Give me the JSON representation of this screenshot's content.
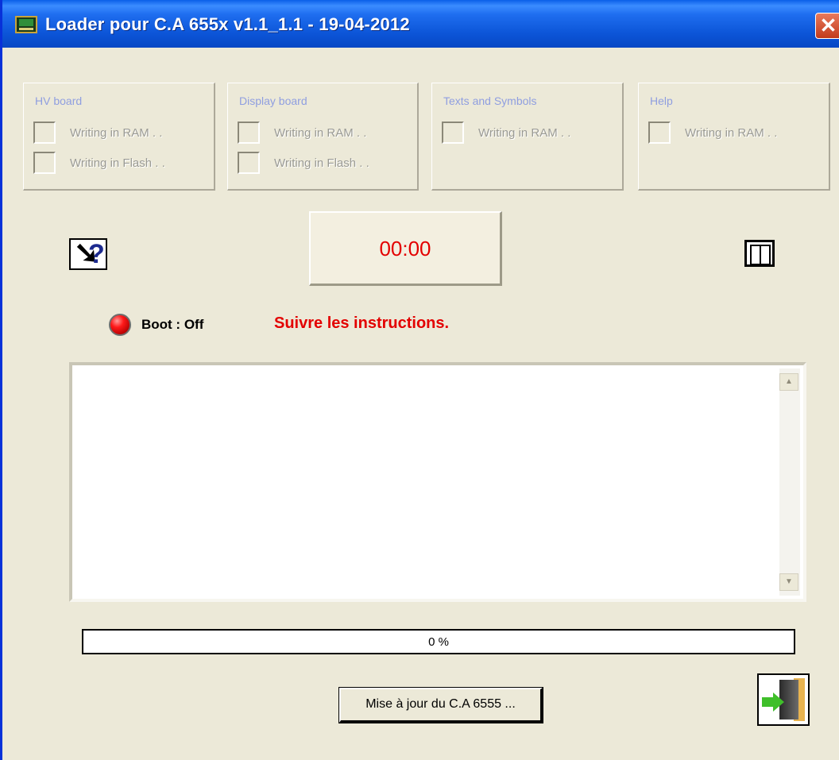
{
  "window": {
    "title": "Loader pour C.A 655x  v1.1_1.1 - 19-04-2012",
    "close_glyph": "✕"
  },
  "groups": [
    {
      "title": "HV board",
      "items": [
        "Writing in RAM . .",
        "Writing in Flash . ."
      ]
    },
    {
      "title": "Display board",
      "items": [
        "Writing in RAM . .",
        "Writing in Flash . ."
      ]
    },
    {
      "title": "Texts and Symbols",
      "items": [
        "Writing in RAM . ."
      ]
    },
    {
      "title": "Help",
      "items": [
        "Writing in RAM . ."
      ]
    }
  ],
  "timer": {
    "value": "00:00",
    "color": "#e30000"
  },
  "status": {
    "boot_label": "Boot : Off",
    "led_color": "#ff1a1a",
    "instructions": "Suivre les instructions.",
    "instructions_color": "#e30000"
  },
  "icons": {
    "help": "help-cursor-icon",
    "book": "book-icon",
    "exit": "exit-door-icon",
    "scroll_up": "▲",
    "scroll_down": "▼"
  },
  "progress": {
    "value": 0,
    "label": "0 %"
  },
  "buttons": {
    "update": "Mise à jour du C.A 6555 ..."
  },
  "help_glyph": {
    "cursor": "➘",
    "mark": "?"
  }
}
